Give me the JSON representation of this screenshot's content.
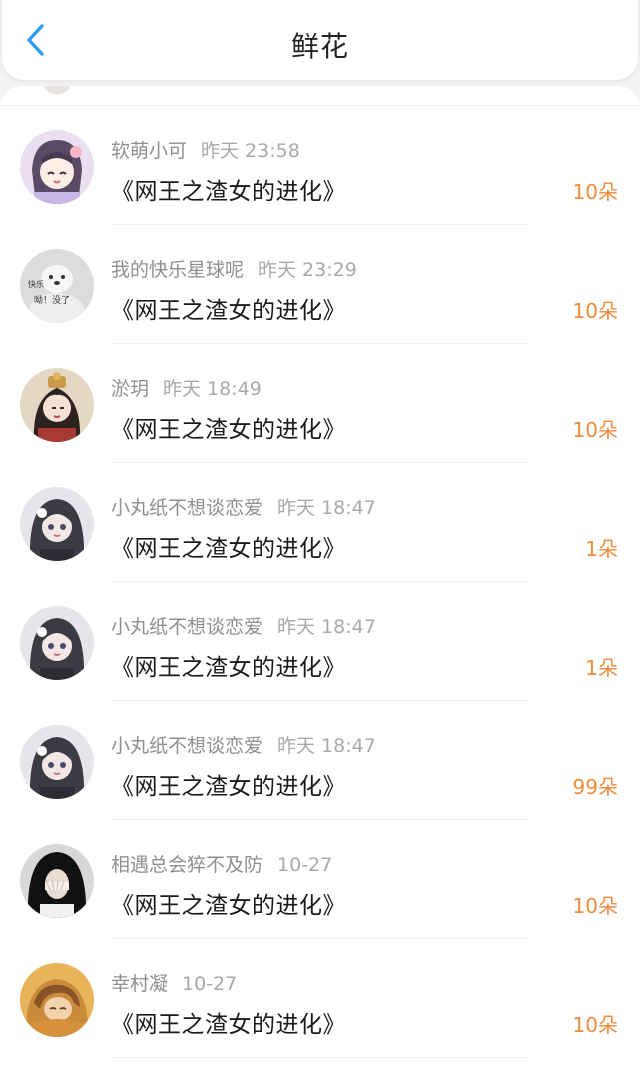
{
  "header": {
    "title": "鲜花",
    "back_icon": "chevron-left-icon",
    "accent_color": "#2d9cf0"
  },
  "flower_color": "#f08a3c",
  "items": [
    {
      "user": "软萌小可",
      "time": "昨天 23:58",
      "book": "《网王之渣女的进化》",
      "flowers": "10朵"
    },
    {
      "user": "我的快乐星球呢",
      "time": "昨天 23:29",
      "book": "《网王之渣女的进化》",
      "flowers": "10朵"
    },
    {
      "user": "淤玥",
      "time": "昨天 18:49",
      "book": "《网王之渣女的进化》",
      "flowers": "10朵"
    },
    {
      "user": "小丸纸不想谈恋爱",
      "time": "昨天 18:47",
      "book": "《网王之渣女的进化》",
      "flowers": "1朵"
    },
    {
      "user": "小丸纸不想谈恋爱",
      "time": "昨天 18:47",
      "book": "《网王之渣女的进化》",
      "flowers": "1朵"
    },
    {
      "user": "小丸纸不想谈恋爱",
      "time": "昨天 18:47",
      "book": "《网王之渣女的进化》",
      "flowers": "99朵"
    },
    {
      "user": "相遇总会猝不及防",
      "time": "10-27",
      "book": "《网王之渣女的进化》",
      "flowers": "10朵"
    },
    {
      "user": "幸村凝",
      "time": "10-27",
      "book": "《网王之渣女的进化》",
      "flowers": "10朵"
    }
  ],
  "avatar_sticker_text": {
    "line1": "快乐",
    "line2": "呦！没了"
  }
}
